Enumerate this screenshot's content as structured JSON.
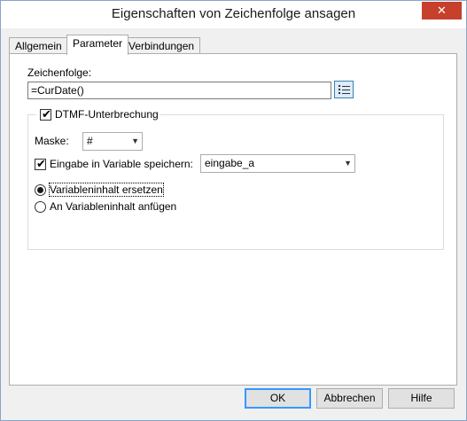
{
  "window": {
    "title": "Eigenschaften von Zeichenfolge ansagen",
    "close_glyph": "✕"
  },
  "tabs": [
    {
      "label": "Allgemein"
    },
    {
      "label": "Parameter"
    },
    {
      "label": "Verbindungen"
    }
  ],
  "parameter": {
    "string_label": "Zeichenfolge:",
    "string_value": "=CurDate()",
    "dtmf_label": "DTMF-Unterbrechung",
    "dtmf_checked": true,
    "mask_label": "Maske:",
    "mask_value": "#",
    "store_label": "Eingabe in Variable speichern:",
    "store_checked": true,
    "variable_value": "eingabe_a",
    "radio_replace_label": "Variableninhalt ersetzen",
    "radio_append_label": "An Variableninhalt anfügen",
    "selected_option": "replace"
  },
  "buttons": {
    "ok": "OK",
    "cancel": "Abbrechen",
    "help": "Hilfe"
  },
  "icons": {
    "check": "✔",
    "dropdown": "▼"
  },
  "colors": {
    "close": "#c7402c",
    "accent": "#3399ff"
  }
}
